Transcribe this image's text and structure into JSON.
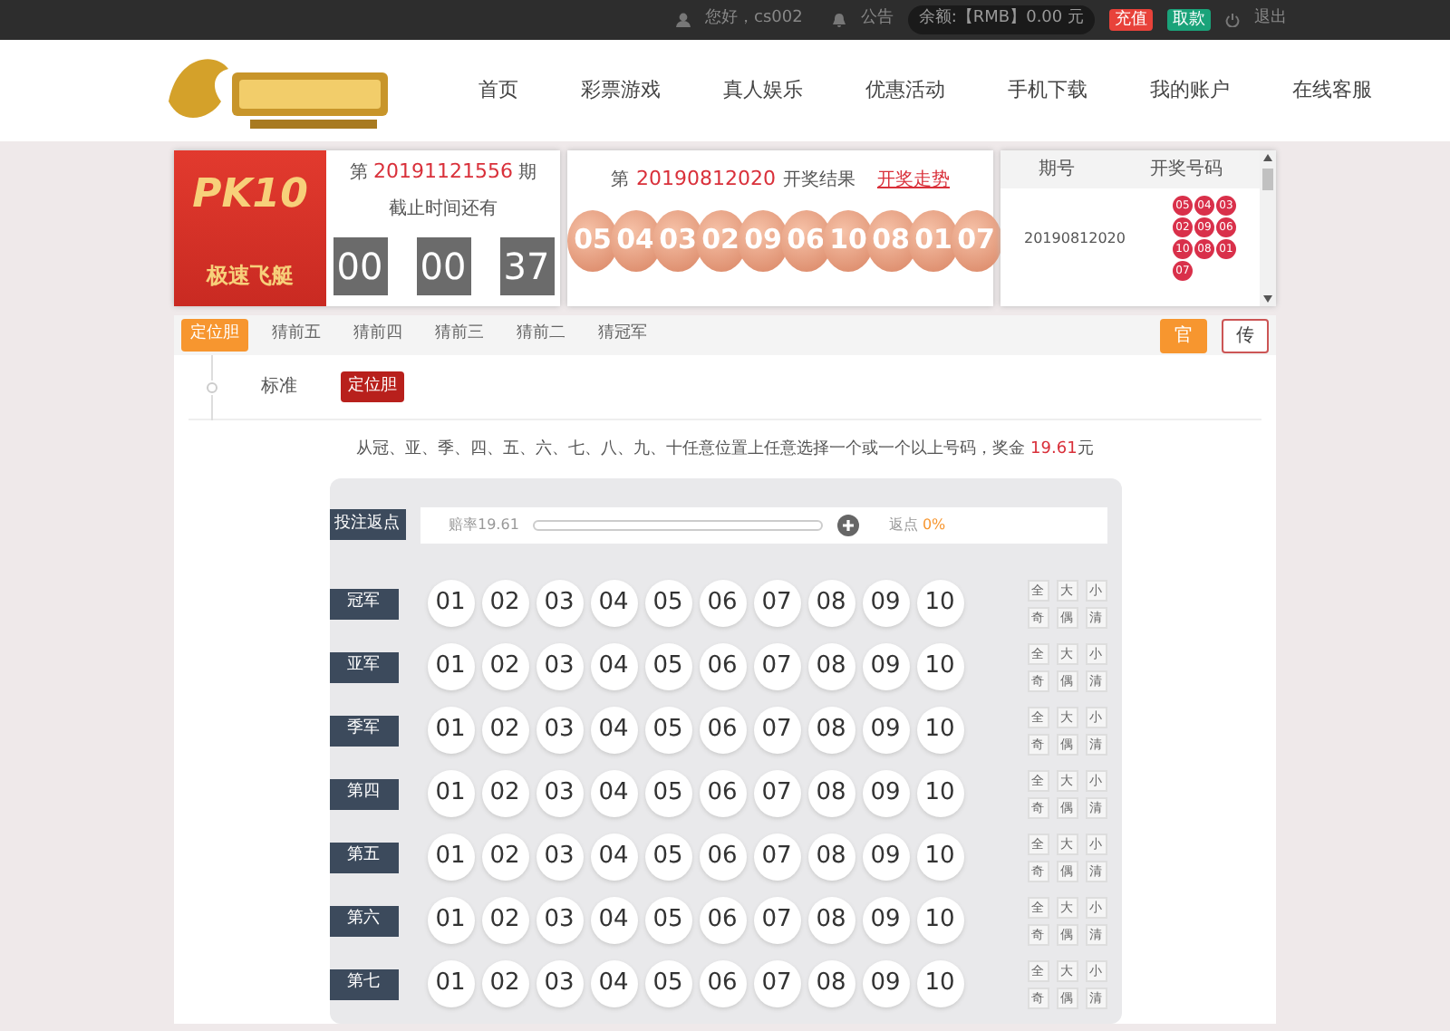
{
  "topbar": {
    "greeting": "您好，cs002",
    "notice": "公告",
    "balance": "余额:【RMB】0.00 元",
    "deposit": "充值",
    "withdraw": "取款",
    "logout": "退出"
  },
  "nav": {
    "items": [
      "首页",
      "彩票游戏",
      "真人娱乐",
      "优惠活动",
      "手机下载",
      "我的账户",
      "在线客服"
    ]
  },
  "game": {
    "badge": "PK10",
    "name": "极速飞艇"
  },
  "current": {
    "prefix": "第",
    "issue": "20191121556",
    "suffix": "期",
    "countdown_label": "截止时间还有",
    "countdown": [
      "00",
      "00",
      "37"
    ]
  },
  "last_draw": {
    "prefix": "第",
    "issue": "20190812020",
    "suffix": "开奖结果",
    "trend_link": "开奖走势",
    "balls": [
      "05",
      "04",
      "03",
      "02",
      "09",
      "06",
      "10",
      "08",
      "01",
      "07"
    ]
  },
  "history": {
    "headers": [
      "期号",
      "开奖号码"
    ],
    "rows": [
      {
        "issue": "20190812020",
        "balls": [
          "05",
          "04",
          "03",
          "02",
          "09",
          "06",
          "10",
          "08",
          "01",
          "07"
        ]
      }
    ]
  },
  "play_tabs": [
    {
      "label": "定位胆",
      "selected": true
    },
    {
      "label": "猜前五",
      "selected": false
    },
    {
      "label": "猜前四",
      "selected": false
    },
    {
      "label": "猜前三",
      "selected": false
    },
    {
      "label": "猜前二",
      "selected": false
    },
    {
      "label": "猜冠军",
      "selected": false
    }
  ],
  "mode_buttons": [
    {
      "label": "官",
      "selected": true
    },
    {
      "label": "传",
      "selected": false
    }
  ],
  "sub_group": {
    "label": "标准",
    "options": [
      {
        "label": "定位胆",
        "selected": true
      }
    ]
  },
  "instruction": {
    "text": "从冠、亚、季、四、五、六、七、八、九、十任意位置上任意选择一个或一个以上号码，奖金",
    "prize": "19.61",
    "unit": "元"
  },
  "rebate": {
    "label": "投注返点",
    "odds": "赔率19.61",
    "rebate_label": "返点",
    "rebate_value": "0%"
  },
  "positions": [
    {
      "label": "冠军",
      "numbers": [
        "01",
        "02",
        "03",
        "04",
        "05",
        "06",
        "07",
        "08",
        "09",
        "10"
      ],
      "quick": [
        "全",
        "大",
        "小",
        "奇",
        "偶",
        "清"
      ]
    },
    {
      "label": "亚军",
      "numbers": [
        "01",
        "02",
        "03",
        "04",
        "05",
        "06",
        "07",
        "08",
        "09",
        "10"
      ],
      "quick": [
        "全",
        "大",
        "小",
        "奇",
        "偶",
        "清"
      ]
    },
    {
      "label": "季军",
      "numbers": [
        "01",
        "02",
        "03",
        "04",
        "05",
        "06",
        "07",
        "08",
        "09",
        "10"
      ],
      "quick": [
        "全",
        "大",
        "小",
        "奇",
        "偶",
        "清"
      ]
    },
    {
      "label": "第四",
      "numbers": [
        "01",
        "02",
        "03",
        "04",
        "05",
        "06",
        "07",
        "08",
        "09",
        "10"
      ],
      "quick": [
        "全",
        "大",
        "小",
        "奇",
        "偶",
        "清"
      ]
    },
    {
      "label": "第五",
      "numbers": [
        "01",
        "02",
        "03",
        "04",
        "05",
        "06",
        "07",
        "08",
        "09",
        "10"
      ],
      "quick": [
        "全",
        "大",
        "小",
        "奇",
        "偶",
        "清"
      ]
    },
    {
      "label": "第六",
      "numbers": [
        "01",
        "02",
        "03",
        "04",
        "05",
        "06",
        "07",
        "08",
        "09",
        "10"
      ],
      "quick": [
        "全",
        "大",
        "小",
        "奇",
        "偶",
        "清"
      ]
    },
    {
      "label": "第七",
      "numbers": [
        "01",
        "02",
        "03",
        "04",
        "05",
        "06",
        "07",
        "08",
        "09",
        "10"
      ],
      "quick": [
        "全",
        "大",
        "小",
        "奇",
        "偶",
        "清"
      ]
    }
  ]
}
